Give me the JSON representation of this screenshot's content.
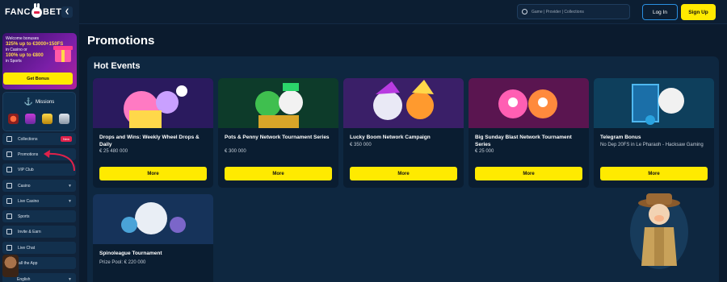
{
  "sidebar": {
    "logo": {
      "text_left": "FANC",
      "text_right": "BET"
    },
    "bonus_card": {
      "line1": "Welcome bonuses",
      "line2_highlight": "325% up to €3000+150FS",
      "line3": "in Casino or",
      "line4_highlight": "100% up to €800",
      "line5": "in Sports",
      "button_label": "Get Bonus"
    },
    "missions": {
      "title": "Missions"
    },
    "nav": [
      {
        "label": "Collections",
        "badge": "New"
      },
      {
        "label": "Promotions"
      },
      {
        "label": "VIP Club"
      },
      {
        "label": "Casino"
      },
      {
        "label": "Live Casino"
      },
      {
        "label": "Sports"
      },
      {
        "label": "Invite & Earn"
      },
      {
        "label": "Live Chat"
      },
      {
        "label": "Install the App"
      },
      {
        "label": "English"
      }
    ]
  },
  "topbar": {
    "search_placeholder": "Game | Provider | Collections",
    "login_label": "Log In",
    "signup_label": "Sign Up"
  },
  "main": {
    "page_title": "Promotions",
    "section_title": "Hot Events",
    "cards": [
      {
        "title": "Drops and Wins: Weekly Wheel Drops & Daily",
        "prize": "€ 25 480 000",
        "button": "More"
      },
      {
        "title": "Pots & Penny Network Tournament Series",
        "prize": "€ 300 000",
        "button": "More"
      },
      {
        "title": "Lucky Boom Network Campaign",
        "prize": "€ 350 000",
        "button": "More"
      },
      {
        "title": "Big Sunday Blast Network Tournament Series",
        "prize": "€ 25 000",
        "button": "More"
      },
      {
        "title": "Telegram Bonus",
        "prize": "No Dep 20FS in Le Pharaoh - Hacksaw Gaming",
        "button": "More"
      },
      {
        "title": "Spinoleague Tournament",
        "prize": "Prize Pool: € 220 000",
        "button": "More"
      }
    ]
  },
  "colors": {
    "accent_yellow": "#ffea00",
    "background": "#0b1b2e",
    "login_border": "#2a8fe0",
    "badge_red": "#e0214a"
  }
}
